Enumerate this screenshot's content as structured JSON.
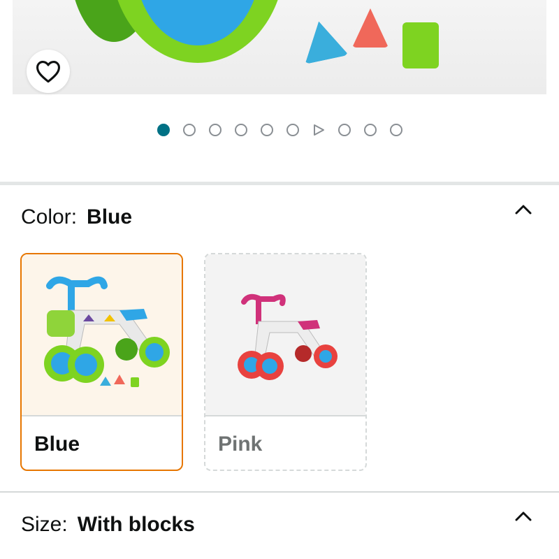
{
  "gallery": {
    "favorite_icon": "heart-outline-icon",
    "dots": [
      {
        "kind": "image",
        "active": true
      },
      {
        "kind": "image",
        "active": false
      },
      {
        "kind": "image",
        "active": false
      },
      {
        "kind": "image",
        "active": false
      },
      {
        "kind": "image",
        "active": false
      },
      {
        "kind": "image",
        "active": false
      },
      {
        "kind": "video",
        "active": false
      },
      {
        "kind": "image",
        "active": false
      },
      {
        "kind": "image",
        "active": false
      },
      {
        "kind": "image",
        "active": false
      }
    ],
    "active_dot_color": "#007185"
  },
  "color_selector": {
    "label": "Color:",
    "selected_value": "Blue",
    "expand_icon": "chevron-up-icon",
    "options": [
      {
        "name": "Blue",
        "selected": true,
        "available": true
      },
      {
        "name": "Pink",
        "selected": false,
        "available": false
      }
    ],
    "selected_border_color": "#e77600"
  },
  "size_selector": {
    "label": "Size:",
    "selected_value": "With blocks",
    "expand_icon": "chevron-up-icon"
  }
}
